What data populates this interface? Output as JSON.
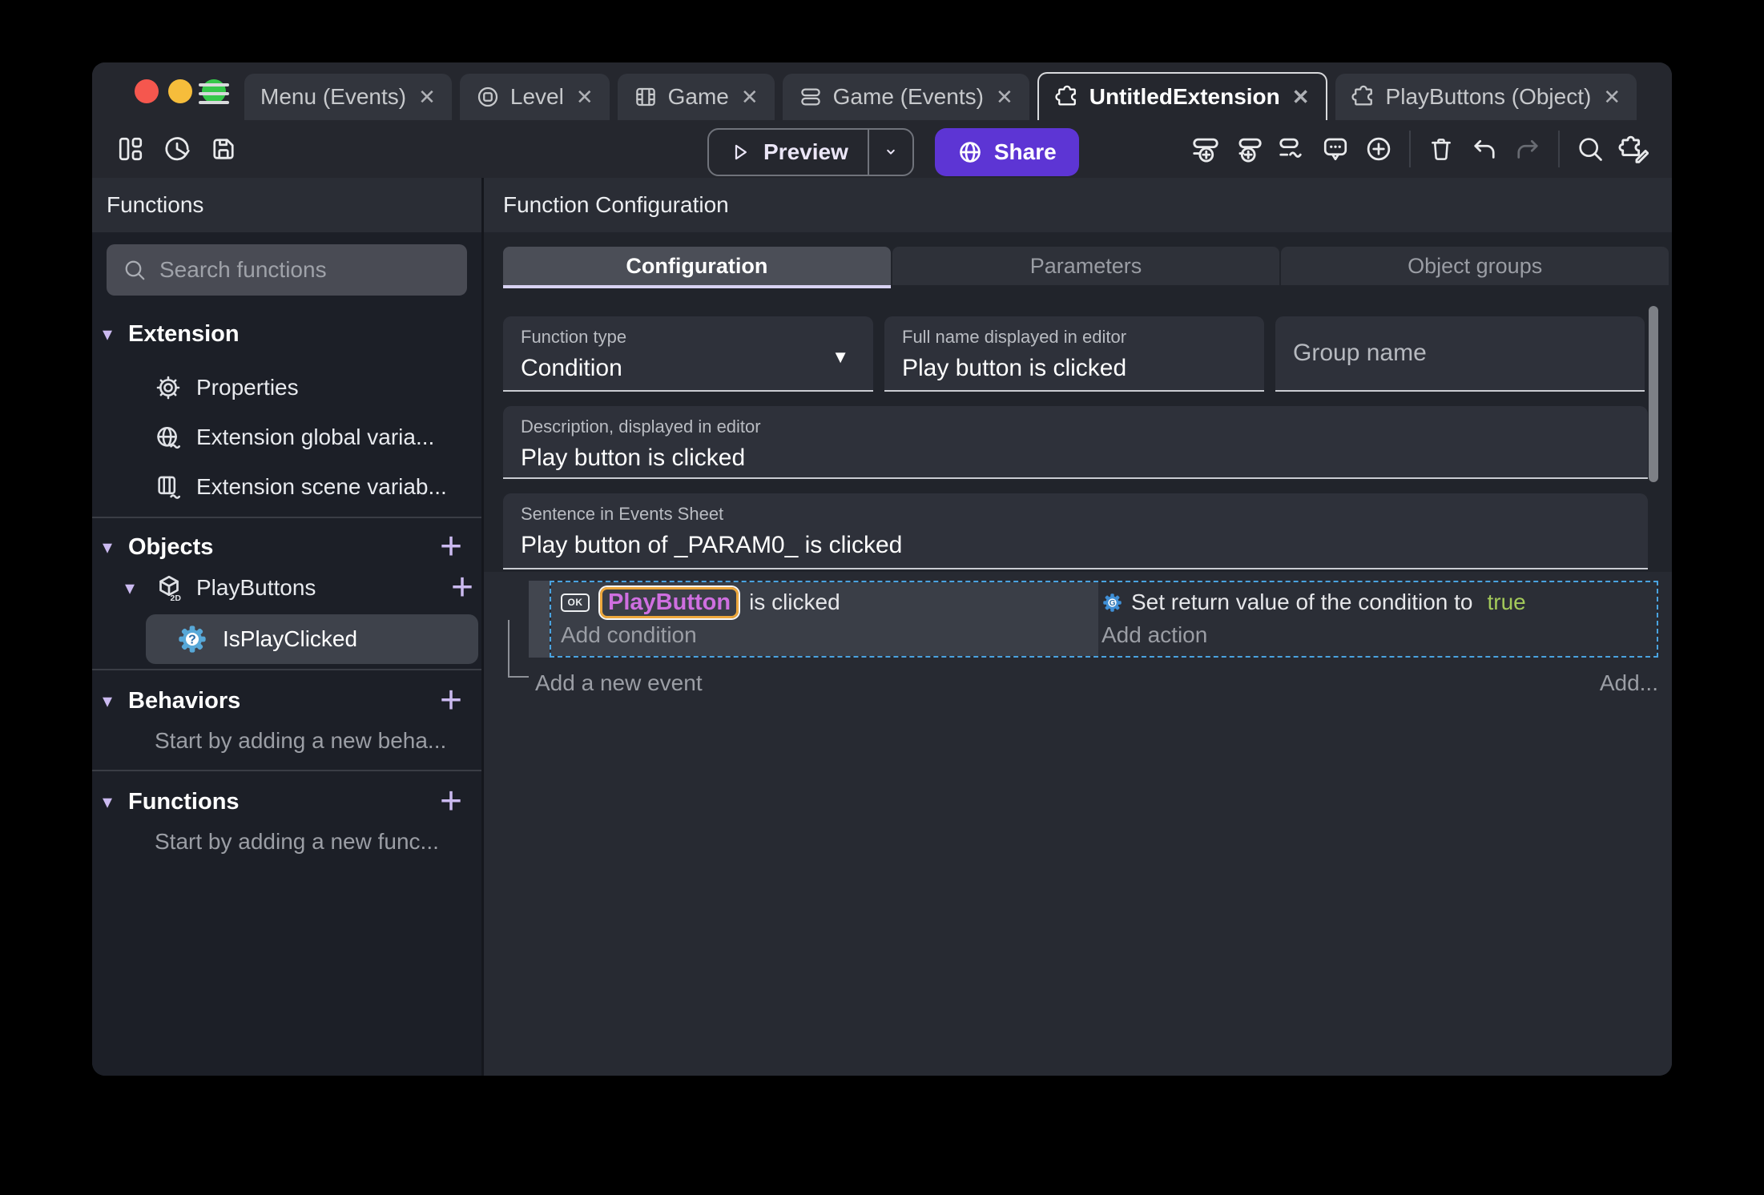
{
  "titlebar": {
    "close_glyph": "✕",
    "tabs": [
      {
        "label": "Menu (Events)"
      },
      {
        "label": "Level"
      },
      {
        "label": "Game"
      },
      {
        "label": "Game (Events)"
      },
      {
        "label": "UntitledExtension"
      },
      {
        "label": "PlayButtons (Object)"
      }
    ]
  },
  "toolbar": {
    "preview_label": "Preview",
    "share_label": "Share"
  },
  "sidebar": {
    "header": "Functions",
    "search_placeholder": "Search functions",
    "extension": {
      "header": "Extension",
      "items": [
        {
          "label": "Properties"
        },
        {
          "label": "Extension global varia..."
        },
        {
          "label": "Extension scene variab..."
        }
      ]
    },
    "objects": {
      "header": "Objects",
      "object_label": "PlayButtons",
      "function_label": "IsPlayClicked"
    },
    "behaviors": {
      "header": "Behaviors",
      "hint": "Start by adding a new beha..."
    },
    "functions": {
      "header": "Functions",
      "hint": "Start by adding a new func..."
    }
  },
  "main": {
    "header": "Function Configuration",
    "tabs": [
      {
        "label": "Configuration"
      },
      {
        "label": "Parameters"
      },
      {
        "label": "Object groups"
      }
    ],
    "fields": {
      "function_type": {
        "label": "Function type",
        "value": "Condition"
      },
      "full_name": {
        "label": "Full name displayed in editor",
        "value": "Play button is clicked"
      },
      "group_name": {
        "placeholder": "Group name"
      },
      "description": {
        "label": "Description, displayed in editor",
        "value": "Play button is clicked"
      },
      "sentence": {
        "label": "Sentence in Events Sheet",
        "value": "Play button of _PARAM0_ is clicked"
      }
    },
    "events": {
      "condition": {
        "object_badge": "OK",
        "object_name": "PlayButton",
        "suffix": "is clicked",
        "add_label": "Add condition"
      },
      "action": {
        "text": "Set return value of the condition to",
        "value": "true",
        "add_label": "Add action"
      },
      "add_event_label": "Add a new event",
      "add_more_label": "Add..."
    }
  },
  "colors": {
    "accent_purple": "#5d35d4",
    "lavender_accent": "#cbbaf0",
    "selection_dashed_blue": "#4aa3e0",
    "object_chip_text": "#cf6fe0",
    "object_chip_border": "#eda73c",
    "boolean_true_green": "#a3c95a",
    "traffic_red": "#f5574e",
    "traffic_yellow": "#f6bd3b",
    "traffic_green": "#36c84b"
  }
}
